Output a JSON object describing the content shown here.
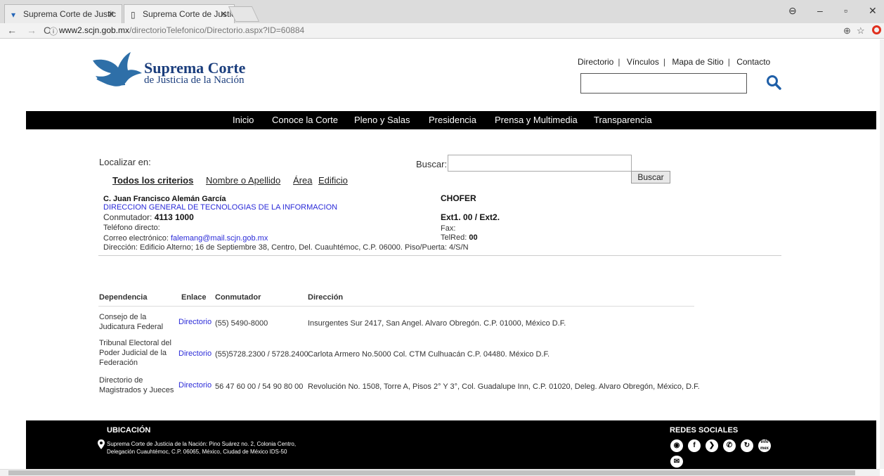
{
  "browser": {
    "tabs": [
      {
        "title": "Suprema Corte de Justic"
      },
      {
        "title": "Suprema Corte de Justic"
      }
    ],
    "url_host": "www2.scjn.gob.mx",
    "url_path": "/directorioTelefonico/Directorio.aspx?ID=60884"
  },
  "header": {
    "logo_main": "Suprema Corte",
    "logo_sub": "de Justicia de la Nación",
    "links": [
      "Directorio",
      "Vínculos",
      "Mapa de Sitio",
      "Contacto"
    ]
  },
  "nav": {
    "items": [
      "Inicio",
      "Conoce la Corte",
      "Pleno y Salas",
      "Presidencia",
      "Prensa y Multimedia",
      "Transparencia"
    ]
  },
  "search": {
    "localizar_label": "Localizar en:",
    "buscar_label": "Buscar:",
    "buscar_button": "Buscar",
    "criteria": [
      "Todos los criterios",
      "Nombre o Apellido",
      "Área",
      "Edificio"
    ]
  },
  "person": {
    "name": "C. Juan Francisco Alemán García",
    "area": "DIRECCION GENERAL DE TECNOLOGIAS DE LA INFORMACION",
    "conmutador_label": "Conmutador:",
    "conmutador_value": "4113 1000",
    "telefono_label": "Teléfono directo:",
    "correo_label": "Correo electrónico:",
    "correo_value": "falemang@mail.scjn.gob.mx",
    "direccion": "Dirección: Edificio Alterno; 16 de Septiembre 38, Centro, Del. Cuauhtémoc, C.P. 06000. Piso/Puerta: 4/S/N",
    "puesto": "CHOFER",
    "ext": "Ext1. 00 / Ext2.",
    "fax_label": "Fax:",
    "telred_label": "TelRed:",
    "telred_value": "00"
  },
  "table": {
    "headers": [
      "Dependencia",
      "Enlace",
      "Conmutador",
      "Dirección"
    ],
    "rows": [
      {
        "dependencia": "Consejo de la Judicatura Federal",
        "enlace": "Directorio",
        "conmutador": "(55) 5490-8000",
        "direccion": "Insurgentes Sur 2417, San Angel. Alvaro Obregón. C.P. 01000, México D.F."
      },
      {
        "dependencia": "Tribunal Electoral del Poder Judicial de la Federación",
        "enlace": "Directorio",
        "conmutador": "(55)5728.2300 / 5728.2400",
        "direccion": "Carlota Armero No.5000 Col. CTM Culhuacán C.P. 04480. México D.F."
      },
      {
        "dependencia": "Directorio de Magistrados y Jueces",
        "enlace": "Directorio",
        "conmutador": "56 47 60 00 / 54 90 80 00",
        "direccion": "Revolución No. 1508, Torre A, Pisos 2° Y 3°, Col. Guadalupe Inn, C.P. 01020, Deleg. Alvaro Obregón, México, D.F."
      }
    ]
  },
  "footer": {
    "ubicacion_title": "UBICACIÓN",
    "address": "Suprema Corte de Justicia de la Nación: Pino Suárez no. 2, Colonia Centro, Delegación Cuauhtémoc, C.P. 06065, México, Ciudad de México IDS-50",
    "redes_title": "REDES SOCIALES",
    "social_icons": [
      "podcast-icon",
      "facebook-icon",
      "twitter-icon",
      "phone-icon",
      "refresh-icon",
      "infomex-icon",
      "mail-icon"
    ]
  }
}
